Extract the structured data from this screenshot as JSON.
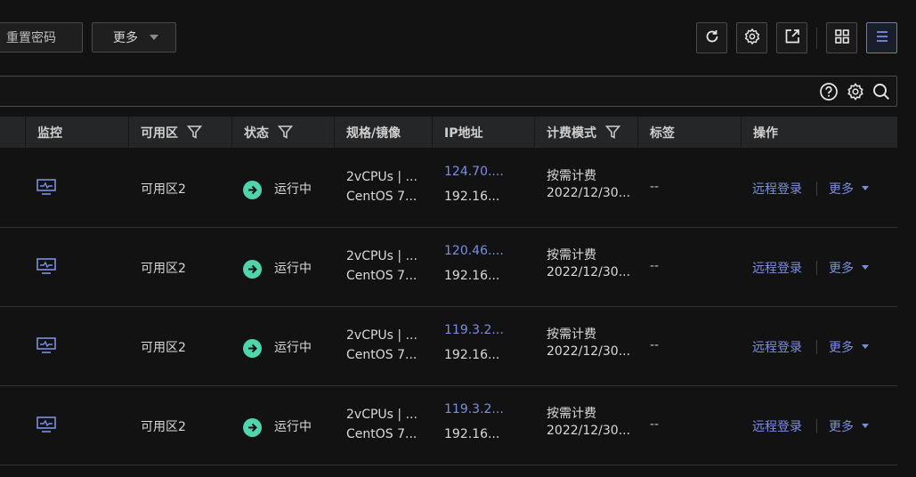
{
  "toolbar": {
    "reset_password_label": "重置密码",
    "more_label": "更多",
    "icons": [
      "refresh-icon",
      "settings-icon",
      "export-icon",
      "grid-view-icon",
      "list-view-icon"
    ]
  },
  "search": {
    "value": "",
    "icons": [
      "help-icon",
      "search-settings-icon",
      "search-icon"
    ]
  },
  "table": {
    "columns": [
      {
        "label": "监控",
        "filter": false
      },
      {
        "label": "可用区",
        "filter": true
      },
      {
        "label": "状态",
        "filter": true
      },
      {
        "label": "规格/镜像",
        "filter": false
      },
      {
        "label": "IP地址",
        "filter": false
      },
      {
        "label": "计费模式",
        "filter": true
      },
      {
        "label": "标签",
        "filter": false
      },
      {
        "label": "操作",
        "filter": false
      }
    ],
    "rows": [
      {
        "zone": "可用区2",
        "status": "运行中",
        "spec": "2vCPUs | ...",
        "image": "CentOS 7...",
        "ip_public": "124.70....",
        "ip_private": "192.16...",
        "billing": "按需计费",
        "billing_date": "2022/12/30...",
        "tags": "--",
        "remote_login": "远程登录",
        "more": "更多"
      },
      {
        "zone": "可用区2",
        "status": "运行中",
        "spec": "2vCPUs | ...",
        "image": "CentOS 7...",
        "ip_public": "120.46....",
        "ip_private": "192.16...",
        "billing": "按需计费",
        "billing_date": "2022/12/30...",
        "tags": "--",
        "remote_login": "远程登录",
        "more": "更多"
      },
      {
        "zone": "可用区2",
        "status": "运行中",
        "spec": "2vCPUs | ...",
        "image": "CentOS 7...",
        "ip_public": "119.3.2...",
        "ip_private": "192.16...",
        "billing": "按需计费",
        "billing_date": "2022/12/30...",
        "tags": "--",
        "remote_login": "远程登录",
        "more": "更多"
      },
      {
        "zone": "可用区2",
        "status": "运行中",
        "spec": "2vCPUs | ...",
        "image": "CentOS 7...",
        "ip_public": "119.3.2...",
        "ip_private": "192.16...",
        "billing": "按需计费",
        "billing_date": "2022/12/30...",
        "tags": "--",
        "remote_login": "远程登录",
        "more": "更多"
      }
    ]
  },
  "colors": {
    "accent": "#5e7ce0",
    "link": "#7b8fe0",
    "status_running": "#50d4ab",
    "background": "#121212",
    "header_bg": "#252628"
  }
}
